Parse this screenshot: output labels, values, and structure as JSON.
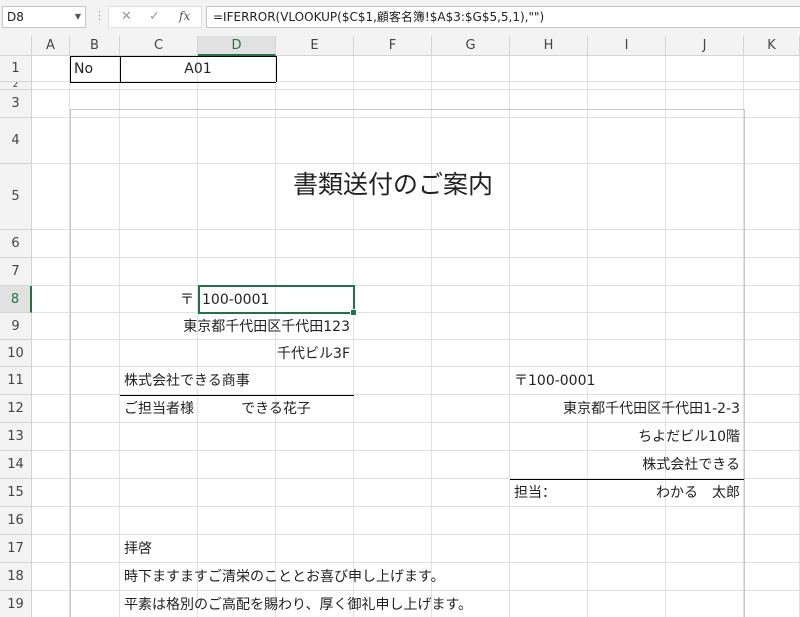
{
  "formula_bar": {
    "name_box": "D8",
    "cancel_symbol": "✕",
    "enter_symbol": "✓",
    "fx_label": "fx",
    "formula": "=IFERROR(VLOOKUP($C$1,顧客名簿!$A$3:$G$5,5,1),\"\")"
  },
  "columns": [
    "A",
    "B",
    "C",
    "D",
    "E",
    "F",
    "G",
    "H",
    "I",
    "J",
    "K"
  ],
  "selected_column": "D",
  "rows": [
    "1",
    "2",
    "3",
    "4",
    "5",
    "6",
    "7",
    "8",
    "9",
    "10",
    "11",
    "12",
    "13",
    "14",
    "15",
    "16",
    "17",
    "18",
    "19"
  ],
  "selected_row": "8",
  "document": {
    "no_label": "No",
    "no_value": "A01",
    "title": "書類送付のご案内",
    "recipient": {
      "postal": "〒",
      "postal_code": "100-0001",
      "address1": "東京都千代田区千代田123",
      "address2": "千代ビル3F",
      "company": "株式会社できる商事",
      "contact_label": "ご担当者様",
      "contact_name": "できる花子"
    },
    "sender": {
      "postal": "〒100-0001",
      "address1": "東京都千代田区千代田1-2-3",
      "address2": "ちよだビル10階",
      "company": "株式会社できる",
      "rep_label": "担当：",
      "rep_name": "わかる　太郎"
    },
    "body": [
      "拝啓",
      "時下ますますご清栄のこととお喜び申し上げます。",
      "平素は格別のご高配を賜わり、厚く御礼申し上げます。"
    ]
  },
  "colors": {
    "accent": "#217346",
    "header_bg": "#f3f3f3",
    "gridline": "#e2e2e2"
  }
}
